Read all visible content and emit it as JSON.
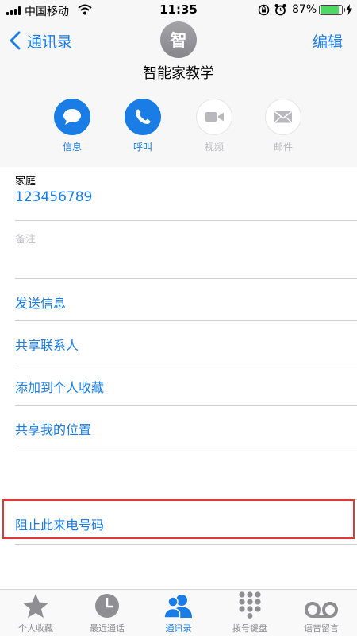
{
  "status_bar": {
    "carrier": "中国移动",
    "time": "11:35",
    "battery": "87%",
    "battery_level": 0.87,
    "icons": [
      "signal-bars-icon",
      "wifi-icon",
      "rotation-lock-icon",
      "alarm-icon",
      "battery-icon",
      "charging-icon"
    ]
  },
  "nav": {
    "back_label": "通讯录",
    "edit_label": "编辑"
  },
  "contact": {
    "avatar_initial": "智",
    "name": "智能家教学"
  },
  "actions": [
    {
      "label": "信息",
      "icon": "message-icon",
      "enabled": true
    },
    {
      "label": "呼叫",
      "icon": "phone-icon",
      "enabled": true
    },
    {
      "label": "视频",
      "icon": "video-icon",
      "enabled": false
    },
    {
      "label": "邮件",
      "icon": "mail-icon",
      "enabled": false
    }
  ],
  "fields": {
    "phone_label": "家庭",
    "phone_value": "123456789",
    "notes_label": "备注"
  },
  "menu": {
    "send_message": "发送信息",
    "share_contact": "共享联系人",
    "add_favorites": "添加到个人收藏",
    "share_location": "共享我的位置",
    "block_caller": "阻止此来电号码"
  },
  "tabs": [
    {
      "label": "个人收藏",
      "icon": "star-icon"
    },
    {
      "label": "最近通话",
      "icon": "clock-icon"
    },
    {
      "label": "通讯录",
      "icon": "contacts-icon",
      "active": true
    },
    {
      "label": "拨号键盘",
      "icon": "keypad-icon"
    },
    {
      "label": "语音留言",
      "icon": "voicemail-icon"
    }
  ],
  "colors": {
    "accent": "#1a7de6",
    "highlight_border": "#dd3a36",
    "disabled": "#b8b8bd",
    "header_bg": "#f7f7f8"
  }
}
